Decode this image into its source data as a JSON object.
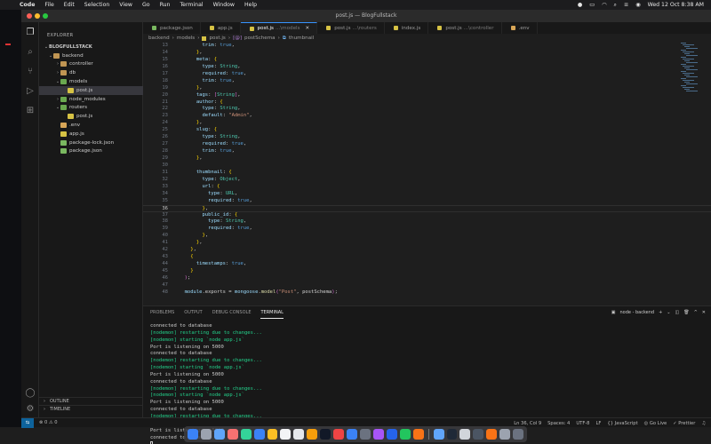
{
  "menubar": {
    "app": "Code",
    "items": [
      "File",
      "Edit",
      "Selection",
      "View",
      "Go",
      "Run",
      "Terminal",
      "Window",
      "Help"
    ],
    "clock": "Wed 12 Oct  8:38 AM"
  },
  "window": {
    "title": "post.js — BlogFullstack"
  },
  "sidebar": {
    "header": "EXPLORER",
    "project": "BLOGFULLSTACK",
    "tree": [
      {
        "label": "backend",
        "depth": 0,
        "type": "folder",
        "open": true
      },
      {
        "label": "controller",
        "depth": 1,
        "type": "folder",
        "open": false
      },
      {
        "label": "db",
        "depth": 1,
        "type": "folder",
        "open": false
      },
      {
        "label": "models",
        "depth": 1,
        "type": "folder",
        "open": true
      },
      {
        "label": "post.js",
        "depth": 2,
        "type": "js",
        "selected": true
      },
      {
        "label": "node_modules",
        "depth": 1,
        "type": "folder",
        "open": false
      },
      {
        "label": "routers",
        "depth": 1,
        "type": "folder",
        "open": true
      },
      {
        "label": "post.js",
        "depth": 2,
        "type": "js"
      },
      {
        "label": ".env",
        "depth": 1,
        "type": "env"
      },
      {
        "label": "app.js",
        "depth": 1,
        "type": "js"
      },
      {
        "label": "package-lock.json",
        "depth": 1,
        "type": "json"
      },
      {
        "label": "package.json",
        "depth": 1,
        "type": "json"
      }
    ],
    "outline": "OUTLINE",
    "timeline": "TIMELINE"
  },
  "tabs": [
    {
      "label": "package.json",
      "hint": "",
      "active": false
    },
    {
      "label": "app.js",
      "hint": "",
      "active": false
    },
    {
      "label": "post.js",
      "hint": "...\\models",
      "active": true
    },
    {
      "label": "post.js",
      "hint": "...\\routers",
      "active": false
    },
    {
      "label": "index.js",
      "hint": "",
      "active": false
    },
    {
      "label": "post.js",
      "hint": "...\\controller",
      "active": false
    },
    {
      "label": ".env",
      "hint": "",
      "active": false
    }
  ],
  "breadcrumb": [
    "backend",
    "models",
    "post.js",
    "postSchema",
    "thumbnail"
  ],
  "editor": {
    "current_line": 36,
    "lines": [
      {
        "n": 13,
        "text": "        trim: true,"
      },
      {
        "n": 14,
        "text": "      },"
      },
      {
        "n": 15,
        "text": "      meta: {"
      },
      {
        "n": 16,
        "text": "        type: String,"
      },
      {
        "n": 17,
        "text": "        required: true,"
      },
      {
        "n": 18,
        "text": "        trim: true,"
      },
      {
        "n": 19,
        "text": "      },"
      },
      {
        "n": 20,
        "text": "      tags: [String],"
      },
      {
        "n": 21,
        "text": "      author: {"
      },
      {
        "n": 22,
        "text": "        type: String,"
      },
      {
        "n": 23,
        "text": "        default: \"Admin\","
      },
      {
        "n": 24,
        "text": "      },"
      },
      {
        "n": 25,
        "text": "      slug: {"
      },
      {
        "n": 26,
        "text": "        type: String,"
      },
      {
        "n": 27,
        "text": "        required: true,"
      },
      {
        "n": 28,
        "text": "        trim: true,"
      },
      {
        "n": 29,
        "text": "      },"
      },
      {
        "n": 30,
        "text": ""
      },
      {
        "n": 31,
        "text": "      thumbnail: {"
      },
      {
        "n": 32,
        "text": "        type: Object,"
      },
      {
        "n": 33,
        "text": "        url: {"
      },
      {
        "n": 34,
        "text": "          type: URL,"
      },
      {
        "n": 35,
        "text": "          required: true,"
      },
      {
        "n": 36,
        "text": "        },"
      },
      {
        "n": 37,
        "text": "        public_id: {"
      },
      {
        "n": 38,
        "text": "          type: String,"
      },
      {
        "n": 39,
        "text": "          required: true,"
      },
      {
        "n": 40,
        "text": "        },"
      },
      {
        "n": 41,
        "text": "      },"
      },
      {
        "n": 42,
        "text": "    },"
      },
      {
        "n": 43,
        "text": "    {"
      },
      {
        "n": 44,
        "text": "      timestamps: true,"
      },
      {
        "n": 45,
        "text": "    }"
      },
      {
        "n": 46,
        "text": "  );"
      },
      {
        "n": 47,
        "text": ""
      },
      {
        "n": 48,
        "text": "  module.exports = mongoose.model(\"Post\", postSchema);"
      }
    ]
  },
  "panel": {
    "tabs": [
      "PROBLEMS",
      "OUTPUT",
      "DEBUG CONSOLE",
      "TERMINAL"
    ],
    "active_tab": "TERMINAL",
    "shell": "node - backend",
    "lines": [
      {
        "text": "connected to database",
        "green": false
      },
      {
        "text": "[nodemon] restarting due to changes...",
        "green": true
      },
      {
        "text": "[nodemon] starting `node app.js`",
        "green": true
      },
      {
        "text": "Port is listening on 5000",
        "green": false
      },
      {
        "text": "connected to database",
        "green": false
      },
      {
        "text": "[nodemon] restarting due to changes...",
        "green": true
      },
      {
        "text": "[nodemon] starting `node app.js`",
        "green": true
      },
      {
        "text": "Port is listening on 5000",
        "green": false
      },
      {
        "text": "connected to database",
        "green": false
      },
      {
        "text": "[nodemon] restarting due to changes...",
        "green": true
      },
      {
        "text": "[nodemon] starting `node app.js`",
        "green": true
      },
      {
        "text": "Port is listening on 5000",
        "green": false
      },
      {
        "text": "connected to database",
        "green": false
      },
      {
        "text": "[nodemon] restarting due to changes...",
        "green": true
      },
      {
        "text": "[nodemon] starting `node app.js`",
        "green": true
      },
      {
        "text": "Port is listening on 5000",
        "green": false
      },
      {
        "text": "connected to database",
        "green": false
      }
    ]
  },
  "statusbar": {
    "errors": "0",
    "warnings": "0",
    "position": "Ln 36, Col 9",
    "spaces": "Spaces: 4",
    "encoding": "UTF-8",
    "eol": "LF",
    "language": "JavaScript",
    "golive": "Go Live",
    "prettier": "Prettier"
  },
  "colors": {
    "accent": "#3794ff",
    "terminal_green": "#23d18b",
    "js_icon": "#d6c244"
  }
}
